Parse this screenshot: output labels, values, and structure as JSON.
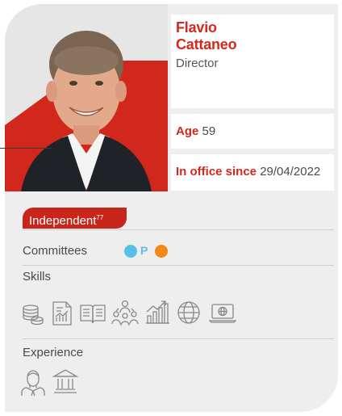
{
  "director": {
    "name_line1": "Flavio",
    "name_line2": "Cattaneo",
    "role": "Director",
    "age_label": "Age",
    "age_value": "59",
    "office_label": "In office since",
    "office_value": "29/04/2022"
  },
  "status": {
    "label": "Independent",
    "footnote": "77"
  },
  "committees": {
    "label": "Committees",
    "items": [
      {
        "icon": "blue-dot-icon",
        "color": "#58bfe9"
      },
      {
        "text": "P"
      },
      {
        "icon": "orange-dot-icon",
        "color": "#f28a1b"
      }
    ]
  },
  "skills": {
    "label": "Skills",
    "icons": [
      "coins-stack-icon",
      "financial-report-icon",
      "open-book-icon",
      "team-people-icon",
      "growth-chart-icon",
      "globe-icon",
      "laptop-globe-icon"
    ]
  },
  "experience": {
    "label": "Experience",
    "icons": [
      "manager-person-icon",
      "institution-building-icon"
    ]
  },
  "colors": {
    "accent_red": "#d7261b",
    "card_bg": "#eeeeee"
  }
}
